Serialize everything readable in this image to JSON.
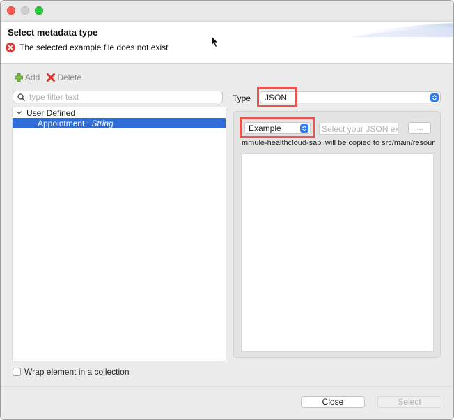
{
  "header": {
    "title": "Select metadata type",
    "error_message": "The selected example file does not exist"
  },
  "toolbar": {
    "add_label": "Add",
    "delete_label": "Delete"
  },
  "filter": {
    "placeholder": "type filter text"
  },
  "tree": {
    "group_label": "User Defined",
    "item_name": "Appointment",
    "item_separator": " : ",
    "item_type": "String"
  },
  "type_field": {
    "label": "Type",
    "value": "JSON"
  },
  "example_panel": {
    "mode_value": "Example",
    "path_placeholder": "Select your JSON ex",
    "browse_label": "...",
    "copy_note": "mmule-healthcloud-sapi will be copied to src/main/resour"
  },
  "options": {
    "wrap_label": "Wrap element in a collection"
  },
  "footer": {
    "close_label": "Close",
    "select_label": "Select"
  },
  "colors": {
    "selection": "#2f6ed8",
    "highlight": "#e8554f",
    "error": "#d63b3b"
  }
}
